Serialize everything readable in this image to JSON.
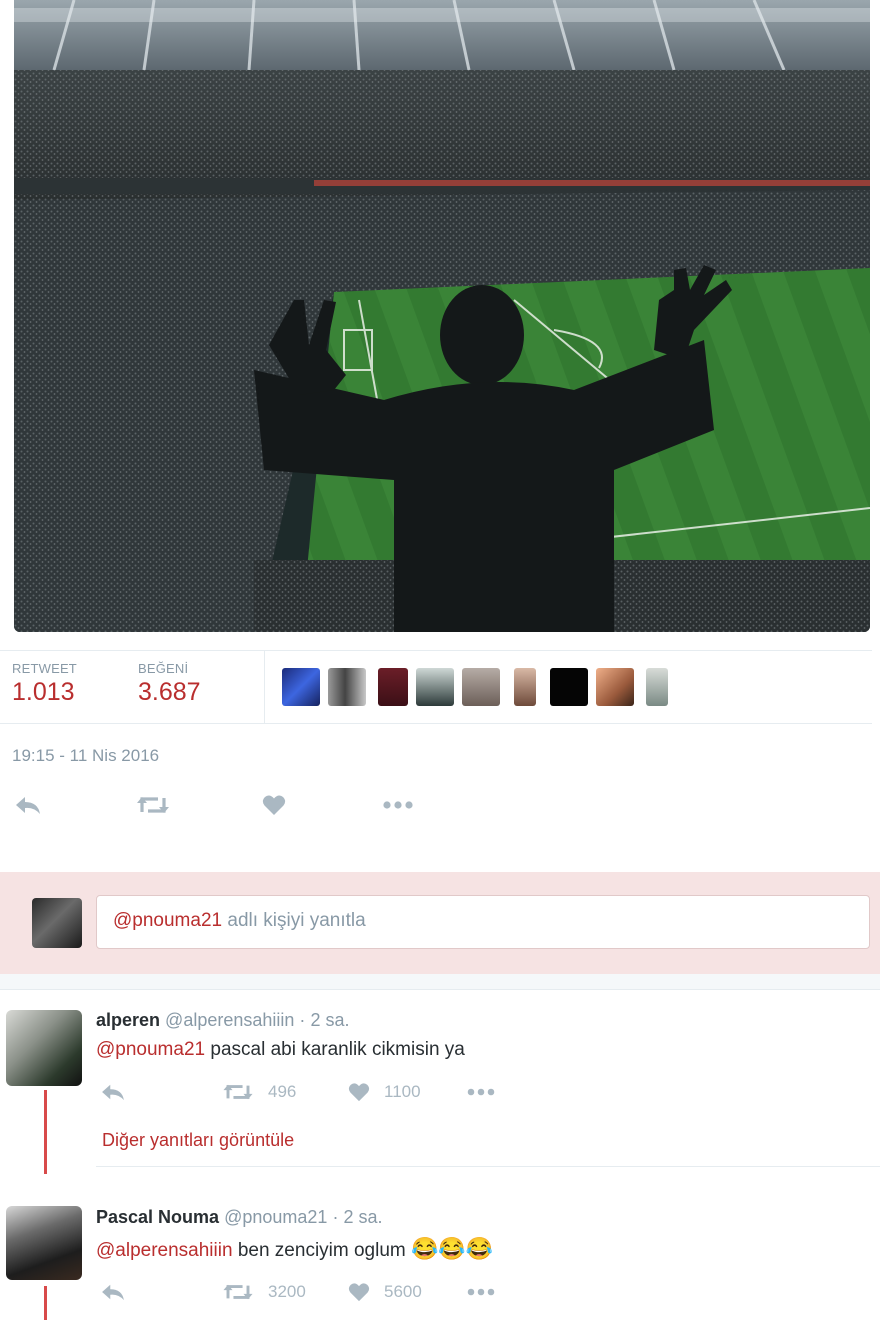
{
  "photo": {
    "alt_icon": "stadium-photo"
  },
  "stats": {
    "retweet_label": "RETWEET",
    "retweet_count": "1.013",
    "like_label": "BEĞENİ",
    "like_count": "3.687"
  },
  "tweet": {
    "timestamp": "19:15 - 11 Nis 2016"
  },
  "reply_box": {
    "mention": "@pnouma21",
    "placeholder_rest": " adlı kişiyi yanıtla"
  },
  "replies": [
    {
      "name": "alperen",
      "handle": "@alperensahiiin",
      "time": "2 sa.",
      "mention": "@pnouma21",
      "text": " pascal abi karanlik cikmisin ya",
      "retweets": "496",
      "likes": "1100",
      "more_replies": "Diğer yanıtları görüntüle"
    },
    {
      "name": "Pascal Nouma",
      "handle": "@pnouma21",
      "time": "2 sa.",
      "mention": "@alperensahiiin",
      "text": " ben zenciyim oglum ",
      "emojis": "😂😂😂",
      "retweets": "3200",
      "likes": "5600"
    }
  ],
  "colors": {
    "accent": "#b92e2e",
    "muted": "#8899a6",
    "icon": "#aab8c2",
    "band": "#f6e3e3"
  }
}
